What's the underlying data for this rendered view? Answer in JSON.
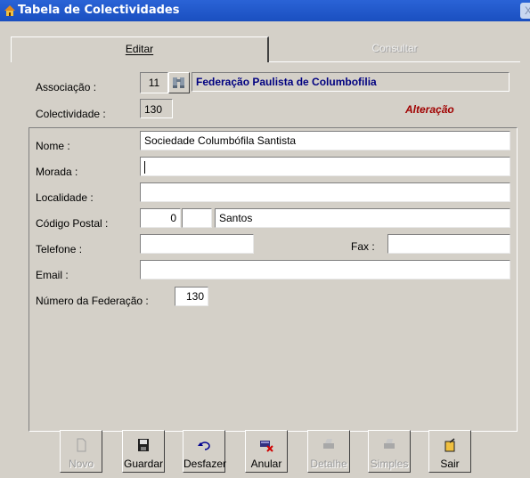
{
  "window": {
    "title": "Tabela de Colectividades",
    "close_label": "X"
  },
  "tabs": [
    {
      "label": "Editar"
    },
    {
      "label": "Consultar"
    }
  ],
  "header": {
    "associacao_label": "Associação :",
    "associacao_code": "11",
    "associacao_name": "Federação Paulista de Columbofilia",
    "colectividade_label": "Colectividade :",
    "colectividade_value": "130",
    "mode_text": "Alteração"
  },
  "form": {
    "nome_label": "Nome :",
    "nome_value": "Sociedade Columbófila Santista",
    "morada_label": "Morada :",
    "morada_value": "",
    "localidade_label": "Localidade :",
    "localidade_value": "",
    "codigo_postal_label": "Código Postal :",
    "codigo_postal_part1": "0",
    "codigo_postal_part2": "",
    "codigo_postal_city": "Santos",
    "telefone_label": "Telefone :",
    "telefone_value": "",
    "fax_label": "Fax :",
    "fax_value": "",
    "email_label": "Email :",
    "email_value": "",
    "numero_federacao_label": "Número da Federação :",
    "numero_federacao_value": "130"
  },
  "toolbar": {
    "novo": "Novo",
    "guardar": "Guardar",
    "desfazer": "Desfazer",
    "anular": "Anular",
    "detalhe": "Detalhe",
    "simples": "Simples",
    "sair": "Sair"
  },
  "colors": {
    "title_bar": "#1a4fc0",
    "org_name_text": "#000080",
    "mode_text": "#a00000",
    "window_bg": "#d4d0c8"
  }
}
